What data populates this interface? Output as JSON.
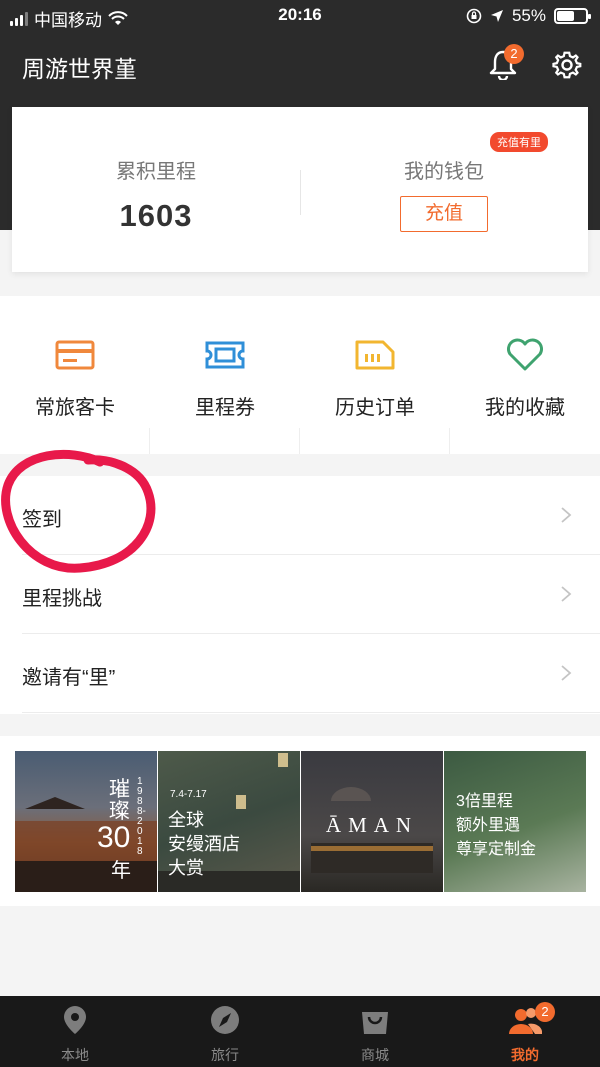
{
  "status_bar": {
    "carrier": "中国移动",
    "time": "20:16",
    "battery": "55%",
    "battery_level": 0.55
  },
  "header": {
    "user_name": "周游世界堇",
    "notification_count": "2"
  },
  "summary": {
    "miles_label": "累积里程",
    "miles_value": "1603",
    "wallet_label": "我的钱包",
    "recharge_button": "充值",
    "promo_tag": "充值有里"
  },
  "shortcuts": [
    {
      "label": "常旅客卡",
      "icon": "card-icon",
      "color": "#f0883c"
    },
    {
      "label": "里程券",
      "icon": "ticket-icon",
      "color": "#2f8fd8"
    },
    {
      "label": "历史订单",
      "icon": "order-icon",
      "color": "#f2b630"
    },
    {
      "label": "我的收藏",
      "icon": "heart-icon",
      "color": "#3fa36f"
    }
  ],
  "menu": [
    {
      "label": "签到"
    },
    {
      "label": "里程挑战"
    },
    {
      "label": "邀请有“里”"
    }
  ],
  "banners": {
    "b1": {
      "vertical_title": "璀璨",
      "years": "1988-2018",
      "big": "30",
      "suffix": "年"
    },
    "b2": {
      "date": "7.4-7.17",
      "line1": "全球",
      "line2": "安缦酒店",
      "line3": "大赏"
    },
    "b3": {
      "logo": "ĀMAN"
    },
    "b4": {
      "line1": "3倍里程",
      "line2": "额外里遇",
      "line3": "尊享定制金"
    }
  },
  "tabbar": {
    "items": [
      {
        "label": "本地",
        "icon": "location-pin-icon"
      },
      {
        "label": "旅行",
        "icon": "compass-icon"
      },
      {
        "label": "商城",
        "icon": "shopping-bag-icon"
      },
      {
        "label": "我的",
        "icon": "user-group-icon",
        "active": true
      }
    ],
    "profile_badge": "2"
  },
  "colors": {
    "accent": "#f26b2e",
    "header_bg": "#2b2b2b",
    "annotation": "#e8194a"
  }
}
